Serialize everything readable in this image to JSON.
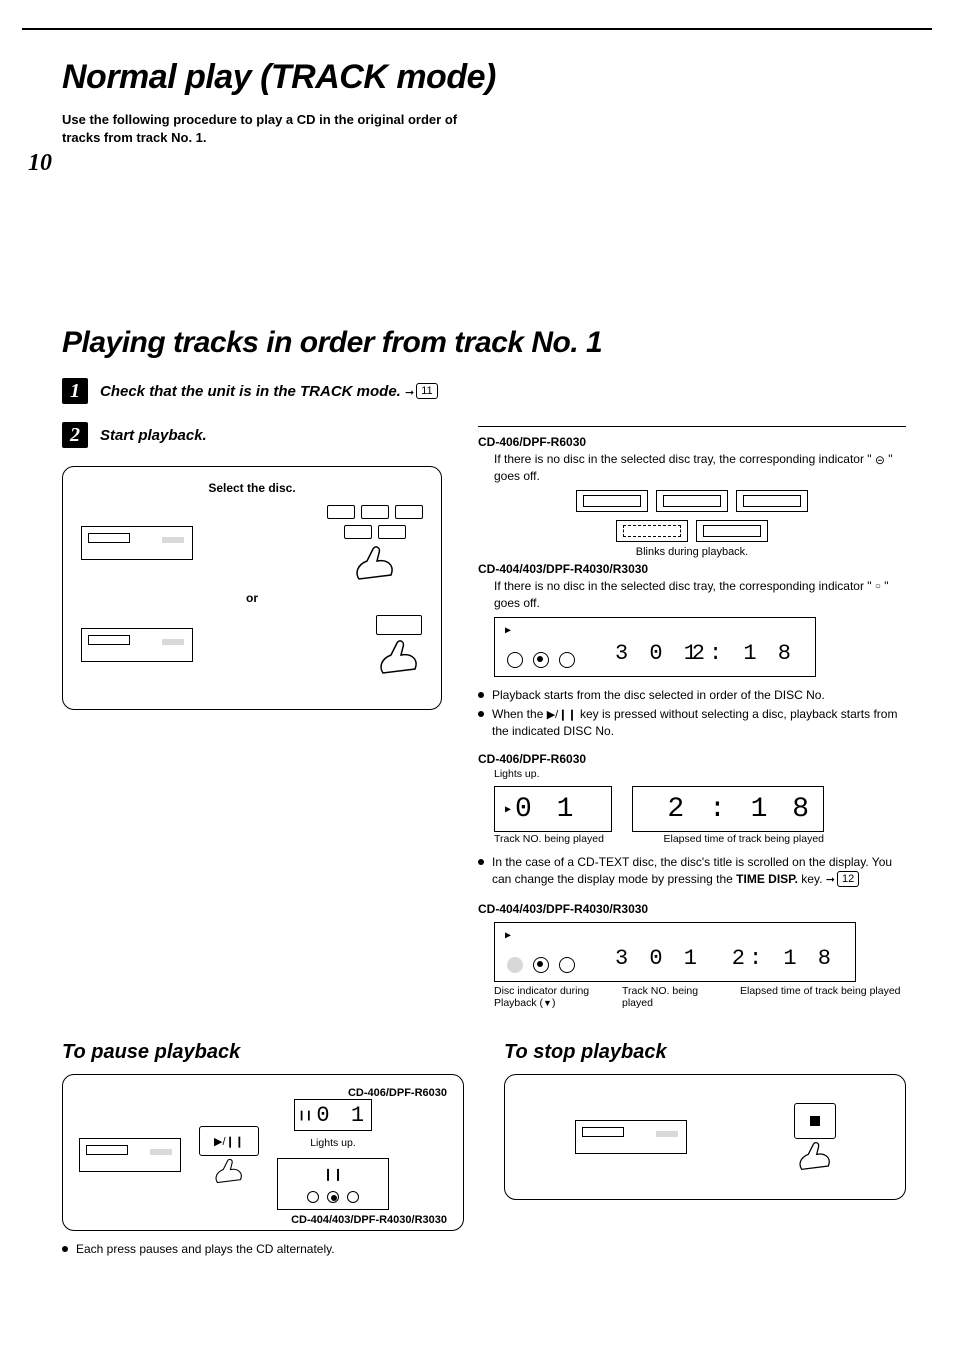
{
  "page_number": "10",
  "title": "Normal play  (TRACK mode)",
  "intro": "Use the following procedure to play a CD in the original order of tracks from track No. 1.",
  "subtitle": "Playing tracks in order from track No. 1",
  "step1": {
    "num": "1",
    "text": "Check that the unit is in the TRACK mode.",
    "ref_page": "11"
  },
  "step2": {
    "num": "2",
    "text": "Start playback."
  },
  "left_panel": {
    "select_disc": "Select the disc.",
    "or": "or"
  },
  "right": {
    "model_a": "CD-406/DPF-R6030",
    "no_disc_a": "If there is no disc in the selected disc tray, the corresponding indicator \"      \" goes off.",
    "blinks_caption": "Blinks during playback.",
    "model_b": "CD-404/403/DPF-R4030/R3030",
    "no_disc_b": "If there is no disc in the selected disc tray, the corresponding indicator \"   \" goes off.",
    "display_b_track": "3 0 1",
    "display_b_time": "2: 1 8",
    "bullets1": [
      "Playback starts from the disc selected in order of the DISC No.",
      "When the      key is pressed without selecting a disc, playback starts from the indicated DISC No."
    ],
    "model_c": "CD-406/DPF-R6030",
    "lights_up": "Lights up.",
    "display_c_left": "0 1",
    "display_c_right": "2 : 1 8",
    "track_no_label": "Track NO. being played",
    "elapsed_label": "Elapsed time of track being played",
    "cdtext_bullet": "In the case of a CD-TEXT disc, the disc's title is scrolled on the display. You can change the display mode by pressing the",
    "time_disp": "TIME DISP.",
    "cdtext_bullet_tail": " key.",
    "cdtext_ref": "12",
    "model_d": "CD-404/403/DPF-R4030/R3030",
    "display_d_track": "3 0 1",
    "display_d_time": "2: 1 8",
    "disc_ind_label": "Disc indicator during Playback (   )"
  },
  "pause": {
    "heading": "To pause playback",
    "model_a": "CD-406/DPF-R6030",
    "mini_lcd": "0 1",
    "lights_up": "Lights up.",
    "model_b": "CD-404/403/DPF-R4030/R3030",
    "footer": "Each press pauses and plays the CD alternately."
  },
  "stop": {
    "heading": "To stop playback"
  }
}
